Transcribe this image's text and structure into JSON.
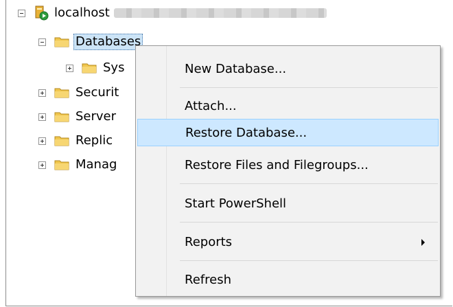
{
  "tree": {
    "server": {
      "label": "localhost"
    },
    "databases": {
      "label": "Databases"
    },
    "children": [
      {
        "label": "Sys"
      },
      {
        "label": "Securit"
      },
      {
        "label": "Server"
      },
      {
        "label": "Replic"
      },
      {
        "label": "Manag"
      }
    ]
  },
  "context_menu": {
    "items": [
      {
        "label": "New Database..."
      },
      {
        "label": "Attach..."
      },
      {
        "label": "Restore Database..."
      },
      {
        "label": "Restore Files and Filegroups..."
      },
      {
        "label": "Start PowerShell"
      },
      {
        "label": "Reports"
      },
      {
        "label": "Refresh"
      }
    ],
    "highlighted_item": "Restore Database..."
  },
  "colors": {
    "selection_bg": "#cce4f7",
    "menu_hover_bg": "#cde8ff",
    "menu_bg": "#f2f2f2"
  }
}
